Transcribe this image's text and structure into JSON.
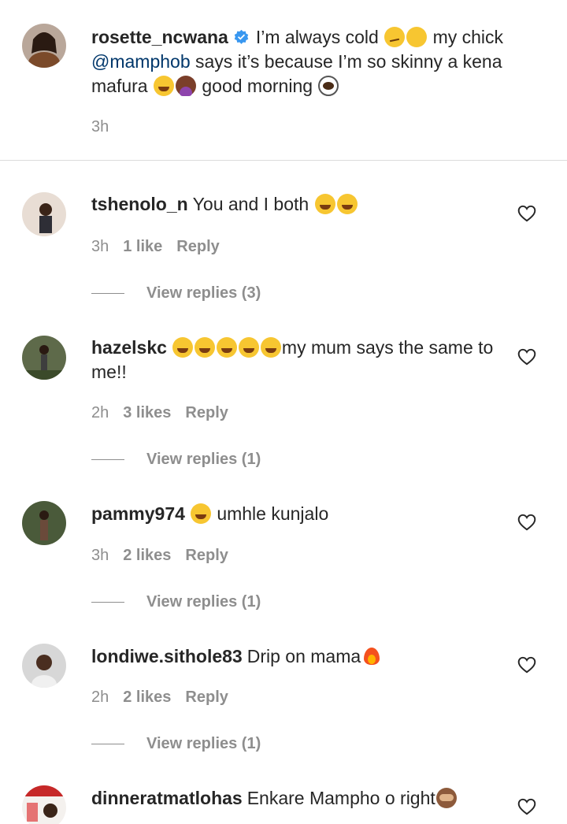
{
  "caption": {
    "username": "rosette_ncwana",
    "verified": true,
    "text_1": "I’m always cold",
    "text_2": "my chick",
    "mention": "@mamphob",
    "text_3": "says it’s because I’m so skinny a kena mafura",
    "text_4": "good morning",
    "time": "3h"
  },
  "comments": [
    {
      "username": "tshenolo_n",
      "text": "You and I both",
      "time": "3h",
      "likes": "1 like",
      "reply": "Reply",
      "view_replies": "View replies (3)"
    },
    {
      "username": "hazelskc",
      "text": "my mum says the same to me!!",
      "time": "2h",
      "likes": "3 likes",
      "reply": "Reply",
      "view_replies": "View replies (1)"
    },
    {
      "username": "pammy974",
      "text": "umhle kunjalo",
      "time": "3h",
      "likes": "2 likes",
      "reply": "Reply",
      "view_replies": "View replies (1)"
    },
    {
      "username": "londiwe.sithole83",
      "text": "Drip on mama",
      "time": "2h",
      "likes": "2 likes",
      "reply": "Reply",
      "view_replies": "View replies (1)"
    },
    {
      "username": "dinneratmatlohas",
      "text": "Enkare Mampho o right"
    }
  ],
  "colors": {
    "text": "#262626",
    "secondary": "#8e8e8e",
    "mention": "#00376b",
    "verified": "#3897f0",
    "divider": "#dbdbdb"
  },
  "icons": {
    "like": "heart-outline-icon",
    "verified": "verified-badge-icon"
  }
}
